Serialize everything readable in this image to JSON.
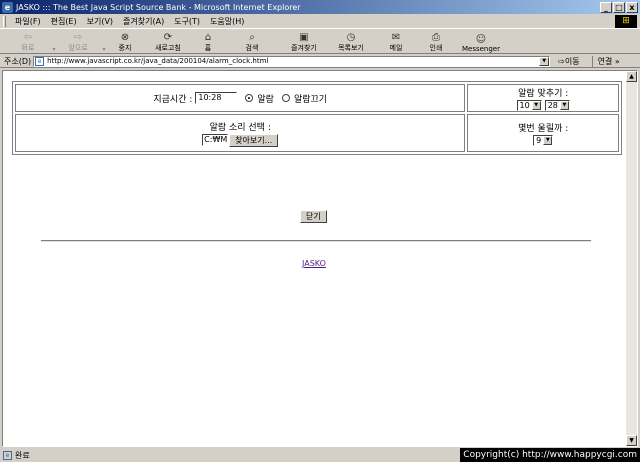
{
  "window": {
    "title": "JASKO ::: The Best Java Script Source Bank - Microsoft Internet Explorer",
    "minimize": "_",
    "maximize": "□",
    "close": "x"
  },
  "menu": [
    "파일(F)",
    "편집(E)",
    "보기(V)",
    "즐겨찾기(A)",
    "도구(T)",
    "도움말(H)"
  ],
  "toolbar": {
    "back": "뒤로",
    "forward": "앞으로",
    "stop": "중지",
    "refresh": "새로고침",
    "home": "홈",
    "search": "검색",
    "favorites": "즐겨찾기",
    "history": "목록보기",
    "mail": "메일",
    "print": "인쇄",
    "messenger": "Messenger"
  },
  "address": {
    "label": "주소(D)",
    "url": "http://www.javascript.co.kr/java_data/200104/alarm_clock.html",
    "go": "이동",
    "links": "연결 »"
  },
  "alarm": {
    "current_time_label": "지금시간 :",
    "current_time_value": "10:28",
    "radio_on_label": "알람",
    "radio_off_label": "알람끄기",
    "set_label": "알람 맞추기 :",
    "hour_value": "10",
    "minute_value": "28",
    "sound_label": "알람 소리 선택 :",
    "file_value": "C:₩M",
    "browse_label": "찾아보기...",
    "repeat_label": "몇번 울릴까 :",
    "repeat_value": "9"
  },
  "page": {
    "close_label": "닫기",
    "link_label": "JASKO"
  },
  "status": {
    "text": "완료",
    "copyright": "Copyright(c) http://www.happycgi.com"
  }
}
